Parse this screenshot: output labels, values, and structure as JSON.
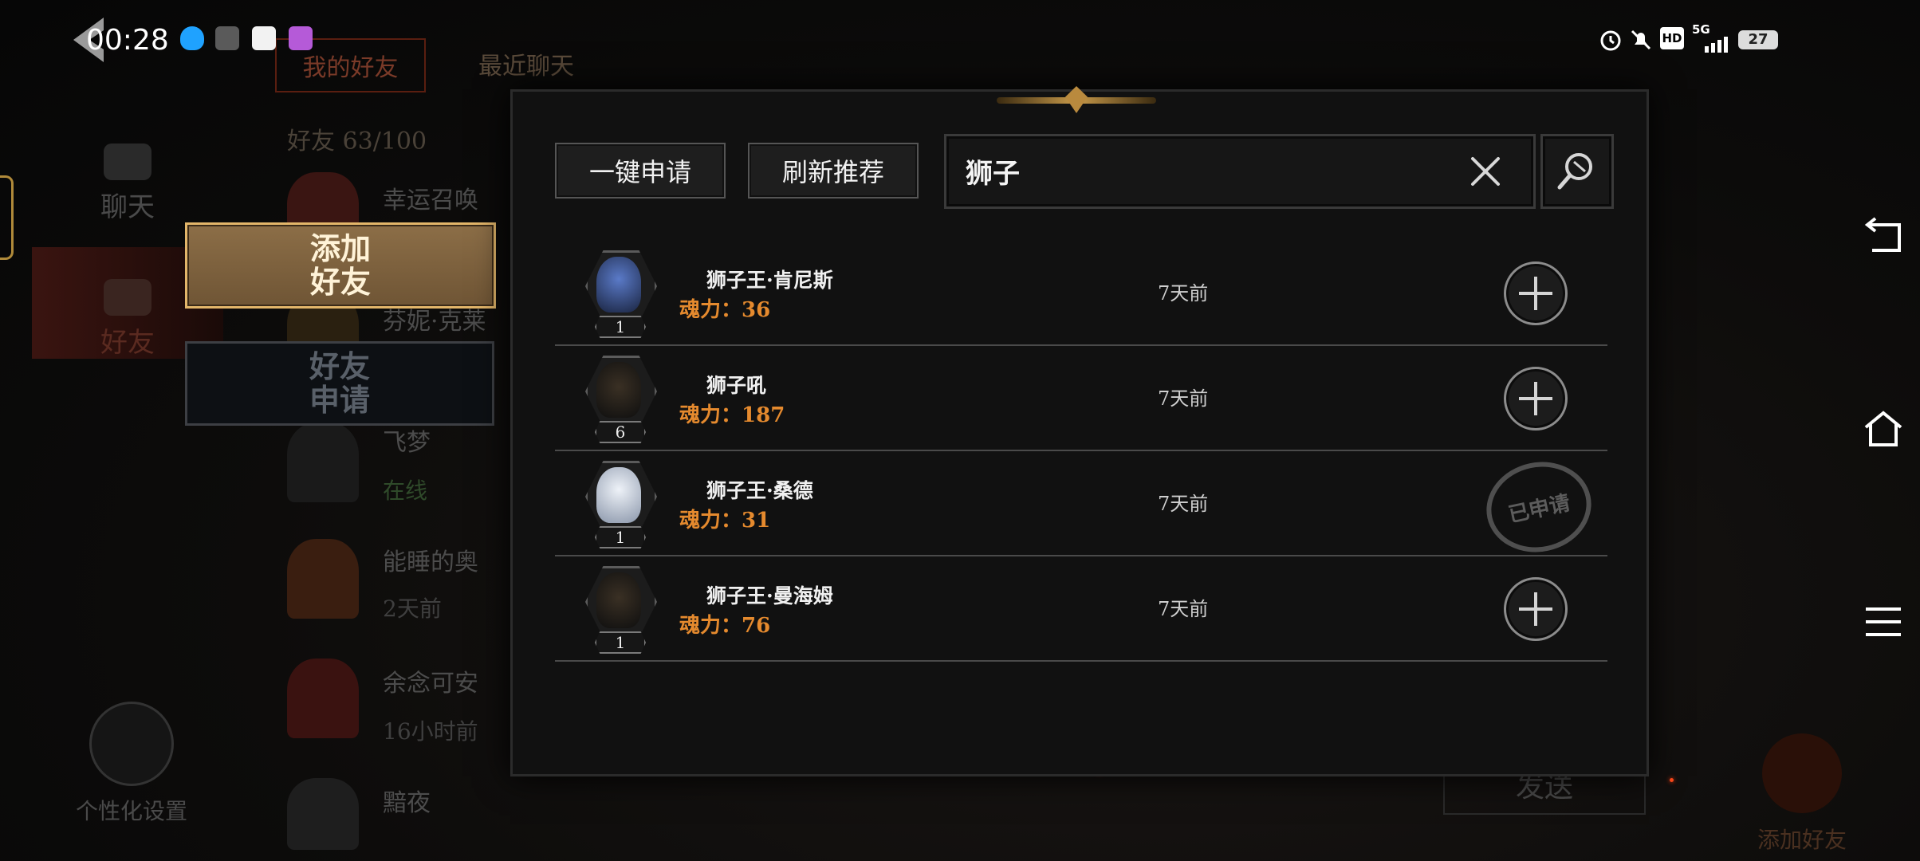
{
  "status_bar": {
    "time": "00:28",
    "network": "5G",
    "hd": "HD",
    "battery": "27"
  },
  "background": {
    "tabs": [
      "我的好友",
      "最近聊天"
    ],
    "friend_count": "好友 63/100",
    "rail": {
      "chat": "聊天",
      "friends": "好友"
    },
    "friends": [
      {
        "name": "幸运召唤",
        "status": ""
      },
      {
        "name": "芬妮·克莱",
        "status": ""
      },
      {
        "name": "飞梦",
        "status": "在线"
      },
      {
        "name": "能睡的奥",
        "status": "2天前"
      },
      {
        "name": "余念可安",
        "status": "16小时前"
      },
      {
        "name": "黯夜",
        "status": ""
      }
    ],
    "personalize": "个性化设置",
    "send": "发送",
    "add_friend": "添加好友"
  },
  "side_buttons": {
    "add_friend": {
      "line1": "添加",
      "line2": "好友"
    },
    "friend_request": {
      "line1": "好友",
      "line2": "申请"
    }
  },
  "modal": {
    "one_key_apply": "一键申请",
    "refresh_recommend": "刷新推荐",
    "search_value": "狮子",
    "results": [
      {
        "name": "狮子王·肯尼斯",
        "power_label": "魂力：",
        "power": "36",
        "level": "1",
        "time": "7天前",
        "state": "add",
        "face": "#2a3a6a"
      },
      {
        "name": "狮子吼",
        "power_label": "魂力：",
        "power": "187",
        "level": "6",
        "time": "7天前",
        "state": "add",
        "face": "#2b2b2b"
      },
      {
        "name": "狮子王·桑德",
        "power_label": "魂力：",
        "power": "31",
        "level": "1",
        "time": "7天前",
        "state": "applied",
        "applied_label": "已申请",
        "face": "#c9d4e4"
      },
      {
        "name": "狮子王·曼海姆",
        "power_label": "魂力：",
        "power": "76",
        "level": "1",
        "time": "7天前",
        "state": "add",
        "face": "#2b2b2b"
      }
    ]
  },
  "colors": {
    "accent_gold": "#e3b66a",
    "power_orange": "#e58a2e",
    "ember": "#ff4a1a"
  },
  "icons": [
    "back-arrow-icon",
    "qq-icon",
    "game-icon",
    "app-icon",
    "bot-icon",
    "alarm-icon",
    "mute-icon",
    "signal-icon",
    "battery-icon",
    "clear-icon",
    "search-icon",
    "add-icon",
    "nav-back-icon",
    "nav-home-icon",
    "nav-menu-icon"
  ]
}
